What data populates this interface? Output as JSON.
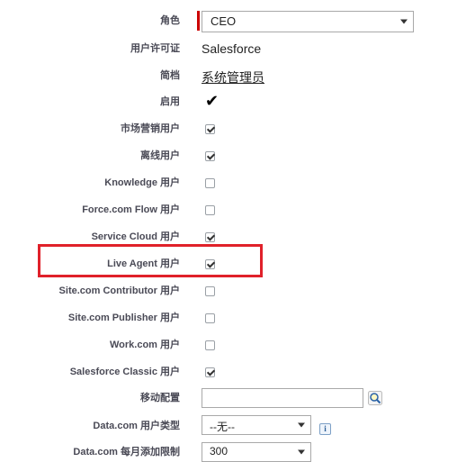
{
  "fields": {
    "role": {
      "label": "角色",
      "value": "CEO"
    },
    "user_license": {
      "label": "用户许可证",
      "value": "Salesforce"
    },
    "profile": {
      "label": "简档",
      "value": "系统管理员"
    },
    "active": {
      "label": "启用",
      "checked": true
    },
    "marketing_user": {
      "label": "市场营销用户",
      "checked": true
    },
    "offline_user": {
      "label": "离线用户",
      "checked": true
    },
    "knowledge_user": {
      "label": "Knowledge 用户",
      "checked": false
    },
    "flow_user": {
      "label": "Force.com Flow 用户",
      "checked": false
    },
    "service_cloud_user": {
      "label": "Service Cloud 用户",
      "checked": true
    },
    "live_agent_user": {
      "label": "Live Agent 用户",
      "checked": true
    },
    "site_contributor_user": {
      "label": "Site.com Contributor 用户",
      "checked": false
    },
    "site_publisher_user": {
      "label": "Site.com Publisher 用户",
      "checked": false
    },
    "work_user": {
      "label": "Work.com 用户",
      "checked": false
    },
    "classic_user": {
      "label": "Salesforce Classic 用户",
      "checked": true
    },
    "mobile_config": {
      "label": "移动配置",
      "value": ""
    },
    "datacom_user_type": {
      "label": "Data.com 用户类型",
      "value": "--无--"
    },
    "datacom_monthly_limit": {
      "label": "Data.com 每月添加限制",
      "value": "300"
    }
  },
  "icons": {
    "lookup": "magnifier-lookup-icon",
    "info": "info-icon"
  },
  "info_glyph": "i",
  "highlight_color": "#e0212a",
  "required_color": "#cc0000"
}
